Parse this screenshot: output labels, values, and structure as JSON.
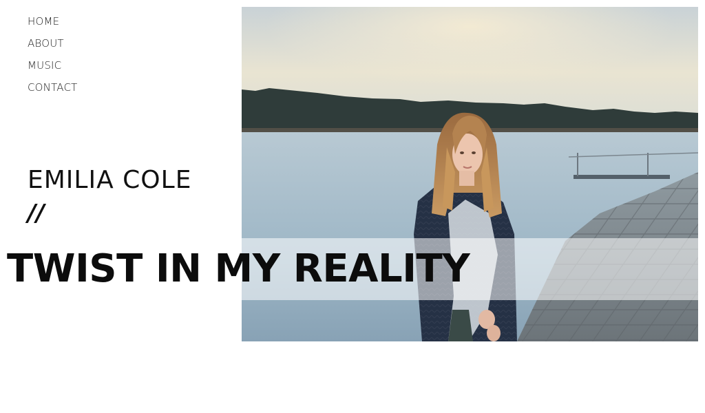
{
  "nav": {
    "items": [
      {
        "label": "HOME"
      },
      {
        "label": "ABOUT"
      },
      {
        "label": "MUSIC"
      },
      {
        "label": "CONTACT"
      }
    ]
  },
  "artist": {
    "name": "EMILIA COLE",
    "separator": "//"
  },
  "hero": {
    "title": "TWIST IN MY REALITY"
  },
  "colors": {
    "text": "#111111",
    "background": "#ffffff",
    "band_overlay": "rgba(255,255,255,0.55)"
  }
}
